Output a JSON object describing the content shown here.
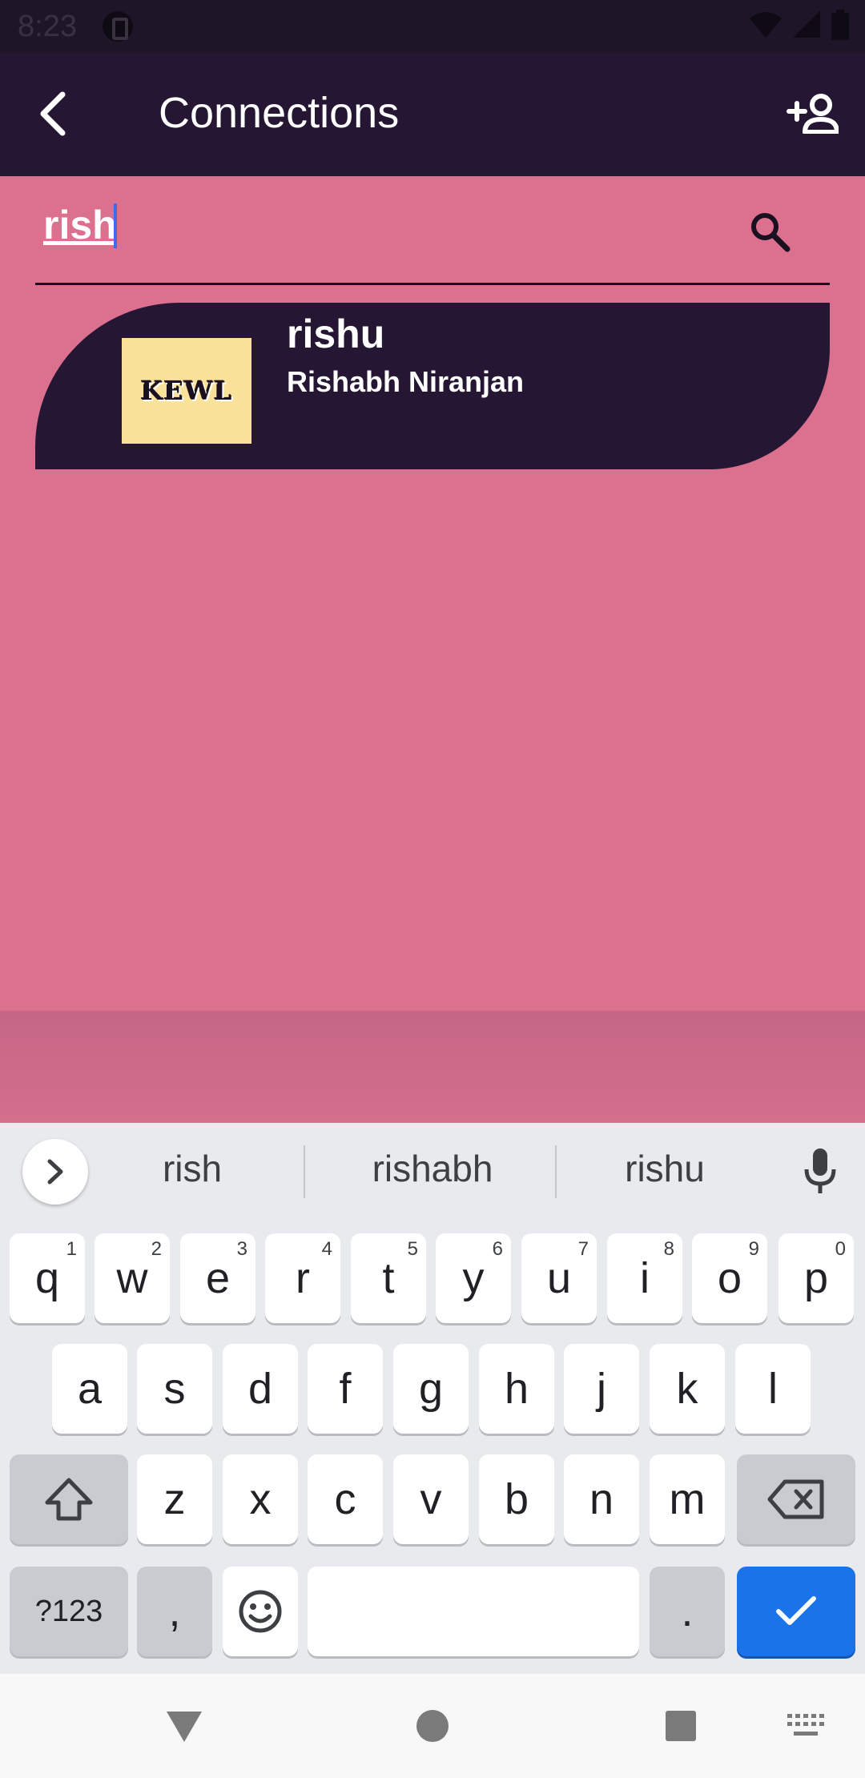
{
  "status_bar": {
    "time": "8:23"
  },
  "app_bar": {
    "title": "Connections"
  },
  "search": {
    "value": "rish"
  },
  "results": [
    {
      "username": "rishu",
      "full_name": "Rishabh Niranjan",
      "avatar_text": "KEWL"
    }
  ],
  "keyboard": {
    "suggestions": [
      "rish",
      "rishabh",
      "rishu"
    ],
    "row1": [
      {
        "key": "q",
        "hint": "1"
      },
      {
        "key": "w",
        "hint": "2"
      },
      {
        "key": "e",
        "hint": "3"
      },
      {
        "key": "r",
        "hint": "4"
      },
      {
        "key": "t",
        "hint": "5"
      },
      {
        "key": "y",
        "hint": "6"
      },
      {
        "key": "u",
        "hint": "7"
      },
      {
        "key": "i",
        "hint": "8"
      },
      {
        "key": "o",
        "hint": "9"
      },
      {
        "key": "p",
        "hint": "0"
      }
    ],
    "row2": [
      "a",
      "s",
      "d",
      "f",
      "g",
      "h",
      "j",
      "k",
      "l"
    ],
    "row3": [
      "z",
      "x",
      "c",
      "v",
      "b",
      "n",
      "m"
    ],
    "symbols_label": "?123",
    "comma": ",",
    "period": "."
  },
  "colors": {
    "app_bar": "#251633",
    "content_bg": "#db708f",
    "card_bg": "#251633",
    "avatar_bg": "#fbe29a",
    "enter_key": "#1a73e8"
  }
}
